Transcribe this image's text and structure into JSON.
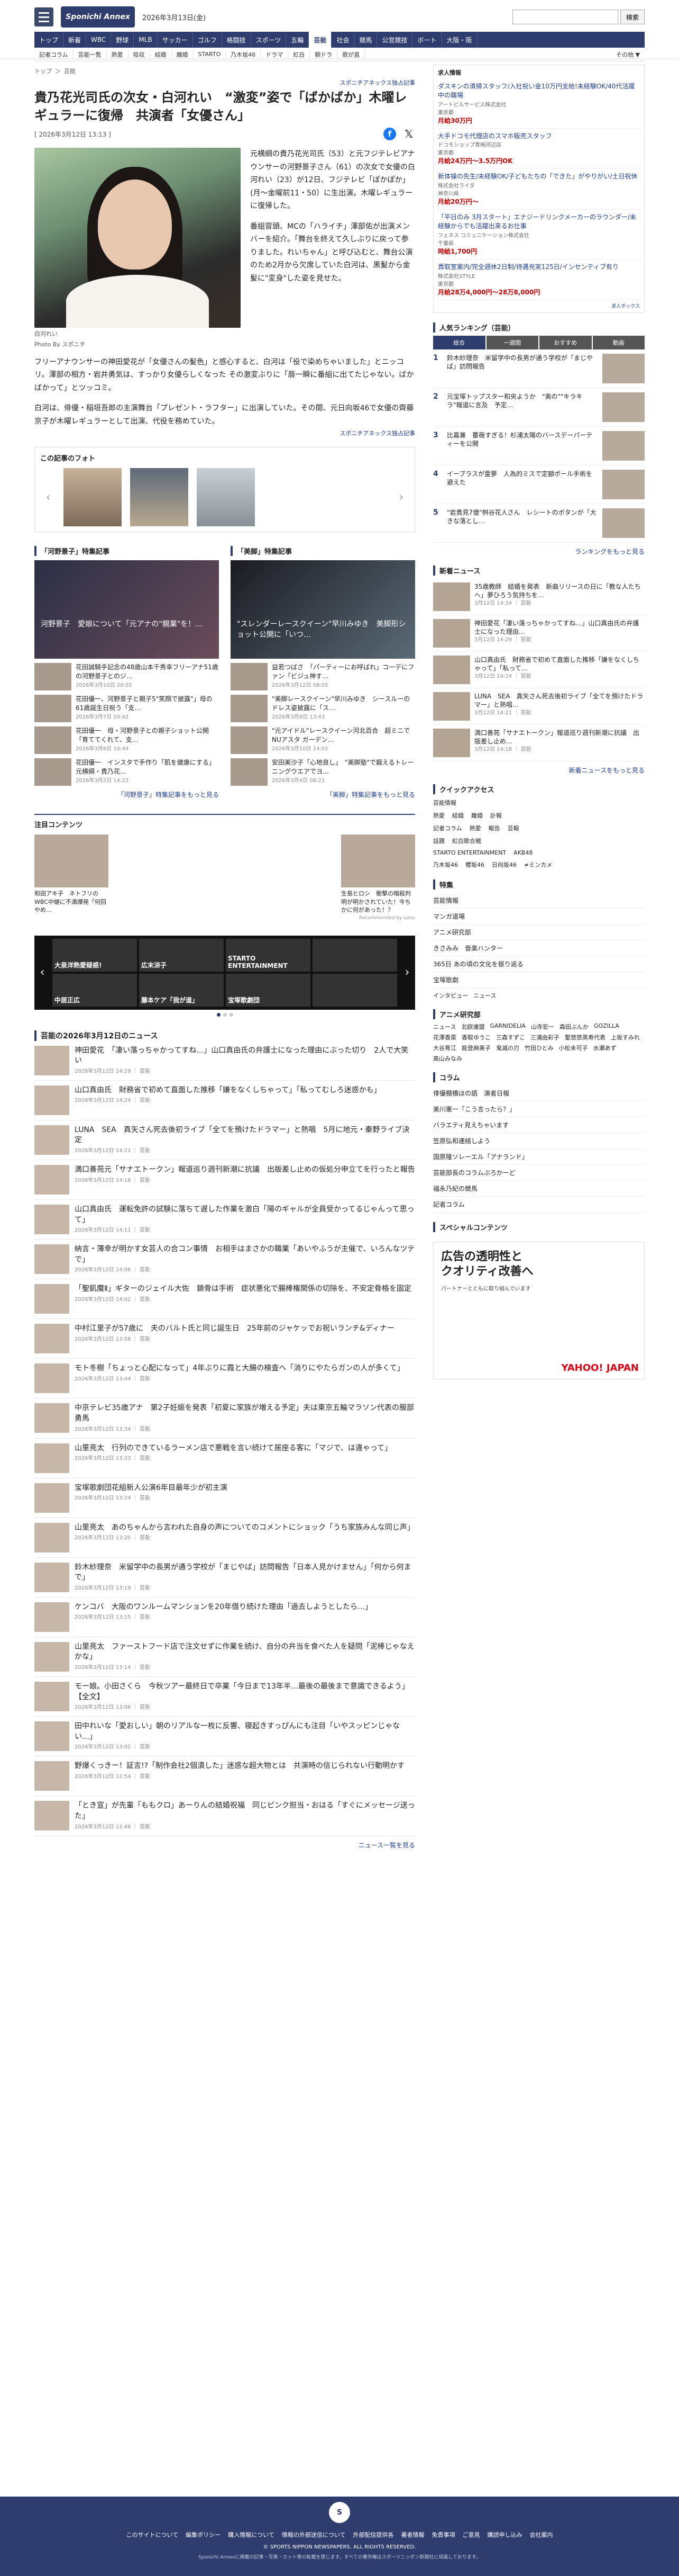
{
  "header": {
    "logo": "Sponichi Annex",
    "date": "2026年3月13日(金)",
    "search_placeholder": "",
    "search_button": "検索",
    "nav": [
      "トップ",
      "新着",
      "WBC",
      "野球",
      "MLB",
      "サッカー",
      "ゴルフ",
      "格闘技",
      "スポーツ",
      "五輪",
      "芸能",
      "社会",
      "競馬",
      "公営競技",
      "ボート",
      "大阪・阪"
    ],
    "nav_active": 10,
    "subnav": [
      "記者コラム",
      "芸能一覧",
      "熱愛",
      "吸収",
      "結婚",
      "離婚",
      "STARTO",
      "乃木坂46",
      "ドラマ",
      "紅白",
      "朝ドラ",
      "歌が直"
    ],
    "subnav_more": "その他 ▼"
  },
  "breadcrumb": [
    "トップ",
    "芸能"
  ],
  "pager": {
    "prev": "前のニュース",
    "next": "次のニュース"
  },
  "article": {
    "source": "スポニチアネックス独占記事",
    "title": "貴乃花光司氏の次女・白河れい　“激変”姿で「ばかばか」木曜レギュラーに復帰　共演者「女優さん」",
    "date": "[ 2026年3月12日 13:13 ]",
    "photo_caption": "白河れい",
    "photo_credit": "Photo By スポニチ",
    "paragraphs": [
      "元横綱の貴乃花光司氏（53）と元フジテレビアナウンサーの河野景子さん（61）の次女で女優の白河れい（23）が12日、フジテレビ「ぽかぽか」(月～金曜前11・50）に生出演。木曜レギュラーに復帰した。",
      "番組冒頭、MCの「ハライチ」澤部佑が出演メンバーを紹介。「舞台を終えて久しぶりに戻って参りました。れいちゃん」と呼び込むと、舞台公演のため2月から欠席していた白河は、黒髪から金髪に\"変身\"した姿を見せた。"
    ],
    "paragraphs_full": [
      "フリーアナウンサーの神田愛花が「女優さんの髪色」と感心すると、白河は「役で染めちゃいました」とニッコリ。澤部の相方・岩井勇気は、すっかり女優らしくなった その激変ぶりに「唇一瞬に番組に出てたじゃない。ばかばかって」とツッコミ。",
      "白河は、俳優・稲垣吾郎の主演舞台「プレゼント・ラフター」に出演していた。その間、元日向坂46で女優の齊藤京子が木曜レギュラーとして出演、代役を務めていた。"
    ],
    "source_bottom": "スポニチアネックス独占記事"
  },
  "photos_box": {
    "title": "この記事のフォト"
  },
  "features": [
    {
      "title": "「河野景子」特集記事",
      "banner": "河野景子　愛娘について「元アナの\"親業\"を！…",
      "items": [
        {
          "text": "花田誠騎手記念の48歳山本千秀幸フリーアナ51歳の河野景子とのジ…",
          "date": "2026年3月10日 20:55"
        },
        {
          "text": "花田優一、河野景子と親子5\"笑顔で披露\"」母の61歳誕生日祝う「支…",
          "date": "2026年3月7日 20:42"
        },
        {
          "text": "花田優一　母・河野景子との親子ショット公開「育ててくれて、支…",
          "date": "2026年3月6日 10:44"
        },
        {
          "text": "花田優一　インスタで手作り「肌を健康にする」元横綱・貴乃花…",
          "date": "2026年3月2日 14:23"
        }
      ],
      "more": "「河野景子」特集記事をもっと見る"
    },
    {
      "title": "「美脚」特集記事",
      "banner": "\"スレンダーレースクイーン\"早川みゆき　美脚形ショット公開に「いつ…",
      "items": [
        {
          "text": "益若つばさ　「パーティーにお呼ばれ」コーデにファン「ビジュ神す…",
          "date": "2026年3月12日 08:05"
        },
        {
          "text": "\"美脚レースクイーン\"早川みゆき　シースルーのドレス姿披露に「ス…",
          "date": "2026年3月9日 13:43"
        },
        {
          "text": "\"元アイドル\"レースクイーン河北百合　超ミニでNUアスタ ガーデン…",
          "date": "2026年3月10日 14:02"
        },
        {
          "text": "安田美沙子「心地良し」　\"美脚塾\"で鍛えるトレーニングウエアでヨ…",
          "date": "2026年3月4日 08:21"
        }
      ],
      "more": "「美脚」特集記事をもっと見る"
    }
  ],
  "attention": {
    "title": "注目コンテンツ",
    "items": [
      {
        "text": "和田アキ子　ネトフリのWBC中継に不満爆発「何回やめ…"
      },
      {
        "text": "生島ヒロシ　衝撃の暗殺判明が明かされていた！今ちかに何があった！？"
      }
    ],
    "recommended": "Recommended by uzou"
  },
  "carousel": {
    "tiles": [
      "大泉洋熱愛疑惑!",
      "広末涼子",
      "STARTO ENTERTAINMENT",
      "",
      "中居正広",
      "藤本ケア「我が道」",
      "宝塚歌劇団",
      ""
    ]
  },
  "news_list": {
    "title": "芸能の2026年3月12日のニュース",
    "items": [
      {
        "text": "神田愛花　「凄い落っちゃかってすね…」山口真由氏の弁護士になった理由にぶった切り　2人で大笑い",
        "date": "2026年3月12日 14:29 ｜ 芸能"
      },
      {
        "text": "山口真由氏　財務省で初めて直面した推移「嫌をなくしちゃって」「私ってむしろ迷惑かも」",
        "date": "2026年3月12日 14:24 ｜ 芸能"
      },
      {
        "text": "LUNA　SEA　真矢さん死去後初ライブ「全てを預けたドラマー」と熱唱　5月に地元・秦野ライブ決定",
        "date": "2026年3月12日 14:21 ｜ 芸能"
      },
      {
        "text": "満口善苑元「サナエトークン」報道巡り週刊新潮に抗議　出版差し止めの仮処分申立てを行ったと報告",
        "date": "2026年3月12日 14:18 ｜ 芸能"
      },
      {
        "text": "山口真由氏　運転免許の試験に落ちて遅した作業を激白「陽のギャルが全員受かってるじゃんって思って」",
        "date": "2026年3月12日 14:11 ｜ 芸能"
      },
      {
        "text": "納言・薄幸が明かす女芸人の合コン事情　お相手はまさかの職業「あいやふうが主催で、いろんなツテで」",
        "date": "2026年3月12日 14:06 ｜ 芸能"
      },
      {
        "text": "「聖飢魔Ⅱ」ギターのジェイル大佐　鎖骨は手術　症状悪化で腸棒権関係の切除を、不安定骨格を固定",
        "date": "2026年3月12日 14:02 ｜ 芸能"
      },
      {
        "text": "中村江里子が57歳に　夫のバルト氏と同じ誕生日　25年前のジャケッでお祝いランチ&ディナー",
        "date": "2026年3月12日 13:58 ｜ 芸能"
      },
      {
        "text": "モト冬樹「ちょっと心配になって」4年ぶりに霞と大腸の検査へ「消りにやたらガンの人が多くて」",
        "date": "2026年3月12日 13:44 ｜ 芸能"
      },
      {
        "text": "中京テレビ35歳アナ　第2子妊娠を発表「初夏に家族が増える予定」夫は東京五輪マラソン代表の服部勇馬",
        "date": "2026年3月12日 13:34 ｜ 芸能"
      },
      {
        "text": "山里亮太　行列のできているラーメン店で悪戦を言い続けて居座る客に「マジで、は違ゃって」",
        "date": "2026年3月12日 13:33 ｜ 芸能"
      },
      {
        "text": "宝塚歌劇団花組新人公演6年目最年少が初主演",
        "date": "2026年3月12日 13:24 ｜ 芸能"
      },
      {
        "text": "山里亮太　あのちゃんから言われた自身の声についてのコメントにショック「うち家族みんな同じ声」",
        "date": "2026年3月12日 13:20 ｜ 芸能"
      },
      {
        "text": "鈴木紗理奈　米留学中の長男が通う学校が「まじやば」訪問報告「日本人見かけません」「何から何まで」",
        "date": "2026年3月12日 13:19 ｜ 芸能"
      },
      {
        "text": "ケンコバ　大阪のワンルームマンションを20年借り続けた理由「過去しようとしたら…」",
        "date": "2026年3月12日 13:15 ｜ 芸能"
      },
      {
        "text": "山里亮太　ファーストフード店で注文せずに作業を続け、自分の弁当を食べた人を疑問「泥棒じゃなえかな」",
        "date": "2026年3月12日 13:14 ｜ 芸能"
      },
      {
        "text": "モー娘。小田さくら　今秋ツアー最終日で卒業「今日まで13年半…最後の最後まで意識できるよう」【全文】",
        "date": "2026年3月12日 13:06 ｜ 芸能"
      },
      {
        "text": "田中れいな「愛おしい」朝のリアルな一枚に反響、寝起きすっぴんにも注目「いやスッピンじゃない…」",
        "date": "2026年3月12日 13:02 ｜ 芸能"
      },
      {
        "text": "野爆くっきー！証言!?「制作会社2個潰した」迷惑な超大物とは　共演時の信じられない行動明かす",
        "date": "2026年3月12日 12:54 ｜ 芸能"
      },
      {
        "text": "「とき宣」が先輩「ももクロ」あーりんの結婚祝福　同じピンク担当・おはる「すぐにメッセージ送った」",
        "date": "2026年3月12日 12:48 ｜ 芸能"
      }
    ],
    "more": "ニュース一覧を見る"
  },
  "sidebar": {
    "ad_header": "求人情報",
    "jobs": [
      {
        "title": "ダスキンの清掃スタッフ/入社祝い金10万円支給!未経験OK/40代活躍中の職場",
        "company": "アートビルサービス株式会社",
        "area": "東京都",
        "salary": "月給30万円"
      },
      {
        "title": "大手ドコモ代理店のスマホ販売スタッフ",
        "company": "ドコモショップ青梅河辺店",
        "area": "東京都",
        "salary": "月給24万円～3.5万円OK"
      },
      {
        "title": "新体操の先生/未経験OK/子どもたちの「できた」がやりがい/土日祝休",
        "company": "株式会社ライダ",
        "area": "神奈川県",
        "salary": "月給20万円～"
      },
      {
        "title": "「平日のみ 3月スタート」エナジードリンクメーカーのラウンダー/未経験からでも活躍出来るお仕事",
        "company": "フェネス コミュニケーション株式会社",
        "area": "千葉県",
        "salary": "時給1,700円"
      },
      {
        "title": "貴取室案内/完全週休2日制/待遇充実125日/インセンティブ有り",
        "company": "株式会社STYLE",
        "area": "東京都",
        "salary": "月給28万4,000円～28万8,000円"
      }
    ],
    "ad_footer": "求人ボックス",
    "ranking": {
      "title": "人気ランキング（芸能）",
      "tabs": [
        "総合",
        "一週間",
        "おすすめ",
        "動画"
      ],
      "items": [
        {
          "rank": "1",
          "text": "鈴木紗理奈　米留学中の長男が通う学校が「まじやば」訪問報告"
        },
        {
          "rank": "2",
          "text": "元宝塚トップスター和央ようか　\"奥の\"\"キラキラ\"報道に言及　予定…"
        },
        {
          "rank": "3",
          "text": "比嘉兼　薔薇すぎる！杉浦太陽のバースデーパーティーを公開"
        },
        {
          "rank": "4",
          "text": "イーブラスが霊夢　人為的ミスで定額ポール手術を避えた"
        },
        {
          "rank": "5",
          "text": "\"岩貴見7億\"桝谷花人さん　レシートのボタンが「大きな落とし…"
        }
      ],
      "more": "ランキングをもっと見る"
    },
    "new_news": {
      "title": "新着ニュース",
      "items": [
        {
          "text": "35歳教師　結婚を発表　新曲リリースの日に「教な人たちへ」夢ひろう気持ちを…",
          "date": "3月12日 14:34 ｜ 芸能"
        },
        {
          "text": "神田愛花「凄い落っちゃかってすね…」山口真由氏の弁護士になった理由…",
          "date": "3月12日 14:29 ｜ 芸能"
        },
        {
          "text": "山口真由氏　財務省で初めて直面した推移「嫌をなくしちゃって」「私って…",
          "date": "3月12日 14:24 ｜ 芸能"
        },
        {
          "text": "LUNA　SEA　真矢さん死去後初ライブ「全てを預けたドラマー」と熱唱…",
          "date": "3月12日 14:21 ｜ 芸能"
        },
        {
          "text": "満口善苑「サナエトークン」報道巡り週刊新潮に抗議　出版差し止め…",
          "date": "3月12日 14:18 ｜ 芸能"
        }
      ],
      "more": "新着ニュースをもっと見る"
    },
    "quick": {
      "title": "クイックアクセス",
      "rows": [
        [
          "芸能情報"
        ],
        [
          "熱愛",
          "結婚",
          "離婚",
          "訃報"
        ],
        [
          "記者コラム",
          "熱愛",
          "報告",
          "芸報"
        ],
        [
          "話題",
          "紅白歌合戦"
        ],
        [
          "STARTO ENTERTAINMENT",
          "AKB48"
        ],
        [
          "乃木坂46",
          "櫻坂46",
          "日向坂46",
          "≠ミンカメ"
        ]
      ]
    },
    "special": {
      "title": "特集",
      "items": [
        "芸能情報",
        "マンガ道場",
        "アニメ研究部",
        "きさみみ　音楽ハンター",
        "365日 あの頃の文化を振り返る",
        "宝塚歌劇"
      ],
      "tags": [
        "インタビュー",
        "ニュース"
      ]
    },
    "anime": {
      "title": "アニメ研究部",
      "tags": [
        "ニュース",
        "北欧連盟",
        "GARNIDELIA",
        "山寺宏一",
        "森田ぶんか",
        "GOZILLA",
        "花澤香菜",
        "香取ゆうこ",
        "三森すずこ",
        "三浦由彩子",
        "聖悠悠英寿代表",
        "上坂すみれ",
        "大谷育江",
        "能登麻美子",
        "鬼滅の刃",
        "竹田ひとみ",
        "小松未可子",
        "水瀬あず",
        "高山みなみ"
      ]
    },
    "column": {
      "title": "コラム",
      "items": [
        "俳優棚橋ほの語　演者日報",
        "美川憲一「こう言ったら？」",
        "バラエティ見えちゃいます",
        "笠原弘和連絡しよう",
        "国原隆ソレーエル「アナランド」",
        "芸能部長のコラムぷろかーど",
        "福永乃紀の競馬",
        "記者コラム"
      ]
    },
    "special_content": "スペシャルコンテンツ",
    "adbig": {
      "l1": "広告の透明性と",
      "l1b": "クオリティ改善へ",
      "l2": "パートナーとともに取り組んでいます",
      "brand": "YAHOO! JAPAN"
    }
  },
  "footer": {
    "logo": "S",
    "links": [
      "このサイトについて",
      "編集ポリシー",
      "購入情報について",
      "情報の外部送信について",
      "外部配信提供各",
      "著者情報",
      "免責事項",
      "ご意見",
      "購読申し込み",
      "会社案内"
    ],
    "copyright": "© SPORTS NIPPON NEWSPAPERS. ALL RIGHTS RESERVED.",
    "note": "Sponichi Annexに掲載の記事・写真・カット等の転載を禁じます。すべての著作権はスポーツニッポン新聞社に帰属しております。"
  }
}
